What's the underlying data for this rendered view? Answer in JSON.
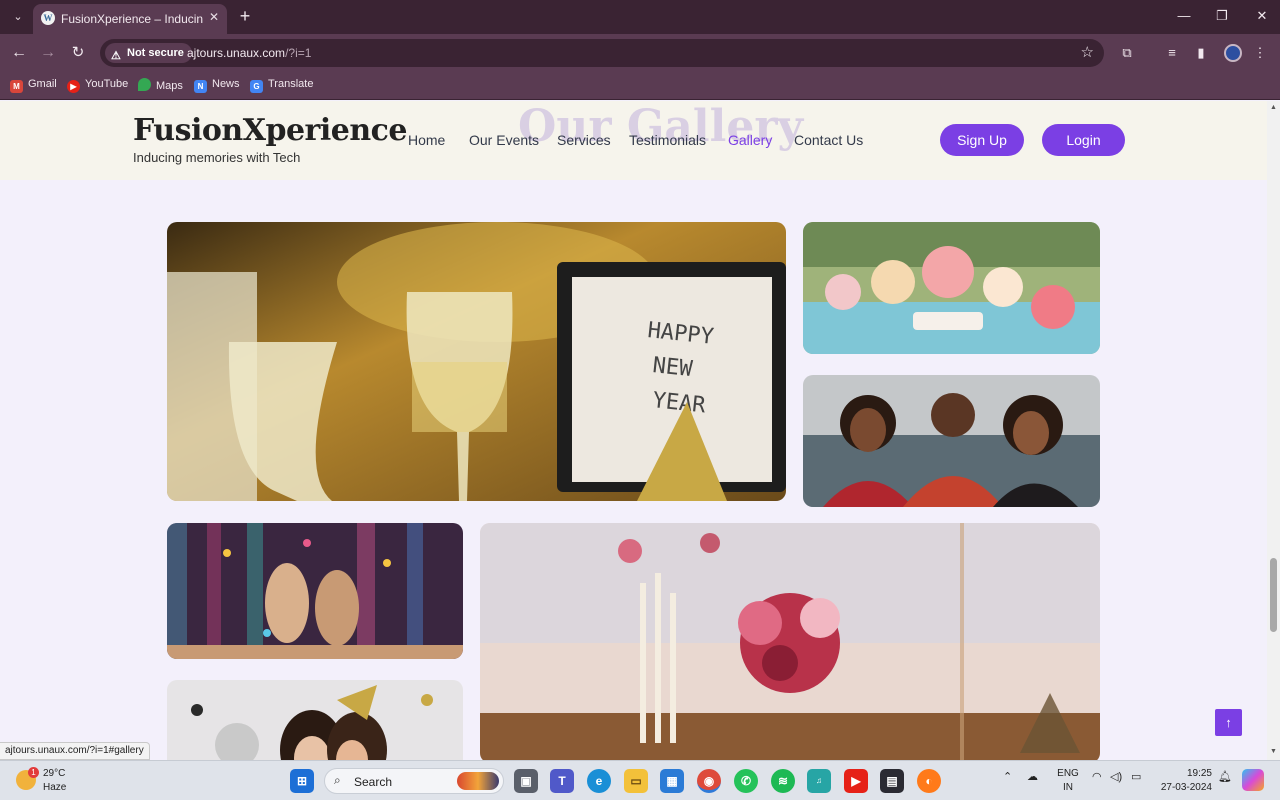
{
  "browser": {
    "tab_title": "FusionXperience – Inducing me",
    "favicon_letter": "W",
    "not_secure_label": "Not secure",
    "url_host": "ajtours.unaux.com",
    "url_path": "/?i=1",
    "bookmarks": [
      "Gmail",
      "YouTube",
      "Maps",
      "News",
      "Translate"
    ],
    "status_url": "ajtours.unaux.com/?i=1#gallery"
  },
  "site": {
    "logo": "FusionXperience",
    "tagline": "Inducing memories with Tech",
    "section_heading": "Our Gallery",
    "nav": [
      "Home",
      "Our Events",
      "Services",
      "Testimonials",
      "Gallery",
      "Contact Us"
    ],
    "active_nav": "Gallery",
    "signup_label": "Sign Up",
    "login_label": "Login",
    "accent_color": "#7b3fe4"
  },
  "gallery": [
    {
      "name": "new-year-champagne-photo",
      "subject": "Champagne glasses with Happy New Year sign"
    },
    {
      "name": "dessert-table-photo",
      "subject": "Outdoor dessert table"
    },
    {
      "name": "friends-selfie-photo",
      "subject": "Group of friends smiling"
    },
    {
      "name": "confetti-party-photo",
      "subject": "Women dancing under confetti"
    },
    {
      "name": "floral-table-photo",
      "subject": "Floral table setting with candles"
    },
    {
      "name": "party-hats-photo",
      "subject": "Two women in party hats"
    }
  ],
  "taskbar": {
    "temperature": "29°C",
    "condition": "Haze",
    "weather_badge": "1",
    "search_label": "Search",
    "lang_top": "ENG",
    "lang_bottom": "IN",
    "time": "19:25",
    "date": "27-03-2024"
  }
}
